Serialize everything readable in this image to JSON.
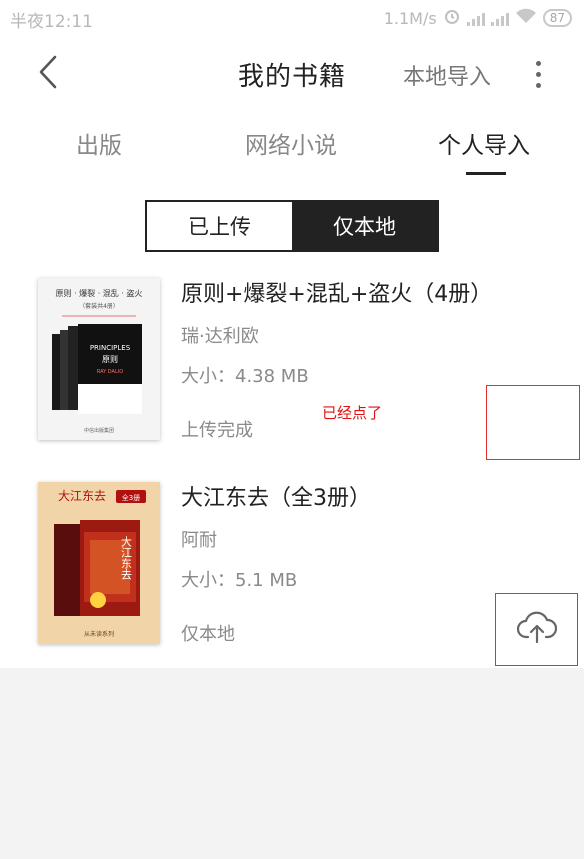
{
  "status_bar": {
    "time": "半夜12:11",
    "speed": "1.1M/s",
    "battery": "87"
  },
  "header": {
    "title": "我的书籍",
    "import_label": "本地导入"
  },
  "tabs": [
    {
      "label": "出版"
    },
    {
      "label": "网络小说"
    },
    {
      "label": "个人导入"
    }
  ],
  "segment": {
    "uploaded": "已上传",
    "local_only": "仅本地"
  },
  "books": [
    {
      "title": "原则+爆裂+混乱+盗火（4册）",
      "author": "瑞·达利欧",
      "size": "大小：4.38 MB",
      "status": "上传完成",
      "cover_text": {
        "headline": "原则 · 爆裂 · 混乱 · 盗火",
        "sub": "（套装共4册）",
        "eng": "PRINCIPLES",
        "cn": "原则",
        "author": "RAY DALIO",
        "publisher": "中信出版集团"
      }
    },
    {
      "title": "大江东去（全3册）",
      "author": "阿耐",
      "size": "大小：5.1 MB",
      "status": "仅本地",
      "cover_text": {
        "headline": "大江东去",
        "badge": "全3册",
        "vertical": "大江东去",
        "publisher": "从未读系列"
      }
    }
  ],
  "annotation": {
    "text": "已经点了",
    "color": "#e01010"
  },
  "icons": {
    "back": "chevron-left-icon",
    "more": "more-vertical-icon",
    "upload": "cloud-upload-icon"
  }
}
